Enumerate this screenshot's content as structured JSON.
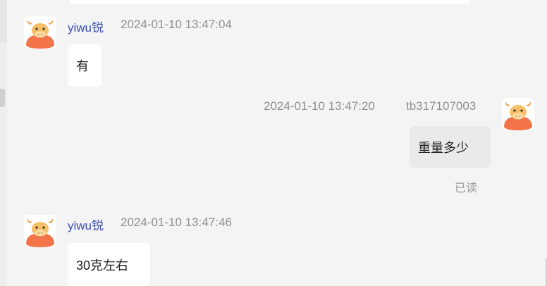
{
  "messages": [
    {
      "sender": "yiwu锐",
      "timestamp": "2024-01-10 13:47:04",
      "text": "有",
      "direction": "incoming"
    },
    {
      "sender": "tb317107003",
      "timestamp": "2024-01-10 13:47:20",
      "text": "重量多少",
      "direction": "outgoing",
      "status": "已读"
    },
    {
      "sender": "yiwu锐",
      "timestamp": "2024-01-10 13:47:46",
      "text": "30克左右",
      "direction": "incoming"
    }
  ],
  "colors": {
    "background": "#f4f4f4",
    "sender_name": "#3b4eb0",
    "timestamp": "#8f8f8f",
    "incoming_bubble": "#ffffff",
    "outgoing_bubble": "#eaeaea"
  },
  "icons": {
    "avatar": "cow-mascot-avatar"
  }
}
